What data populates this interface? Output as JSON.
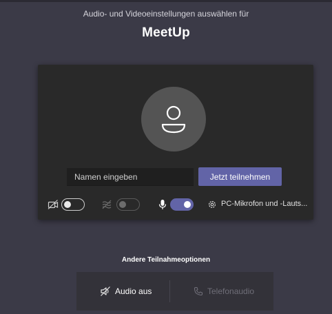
{
  "header": {
    "subtitle": "Audio- und Videoeinstellungen auswählen für",
    "title": "MeetUp"
  },
  "join": {
    "name_placeholder": "Namen eingeben",
    "join_label": "Jetzt teilnehmen"
  },
  "controls": {
    "camera": {
      "icon": "camera-off-icon",
      "state": "off"
    },
    "blur": {
      "icon": "background-blur-icon",
      "state": "disabled"
    },
    "microphone": {
      "icon": "microphone-icon",
      "state": "on"
    },
    "device": {
      "icon": "gear-icon",
      "label": "PC-Mikrofon und -Lauts..."
    }
  },
  "other_options": {
    "title": "Andere Teilnahmeoptionen",
    "audio_off_label": "Audio aus",
    "phone_audio_label": "Telefonaudio"
  },
  "colors": {
    "background": "#3b3a47",
    "card": "#292929",
    "accent": "#6264a7"
  }
}
